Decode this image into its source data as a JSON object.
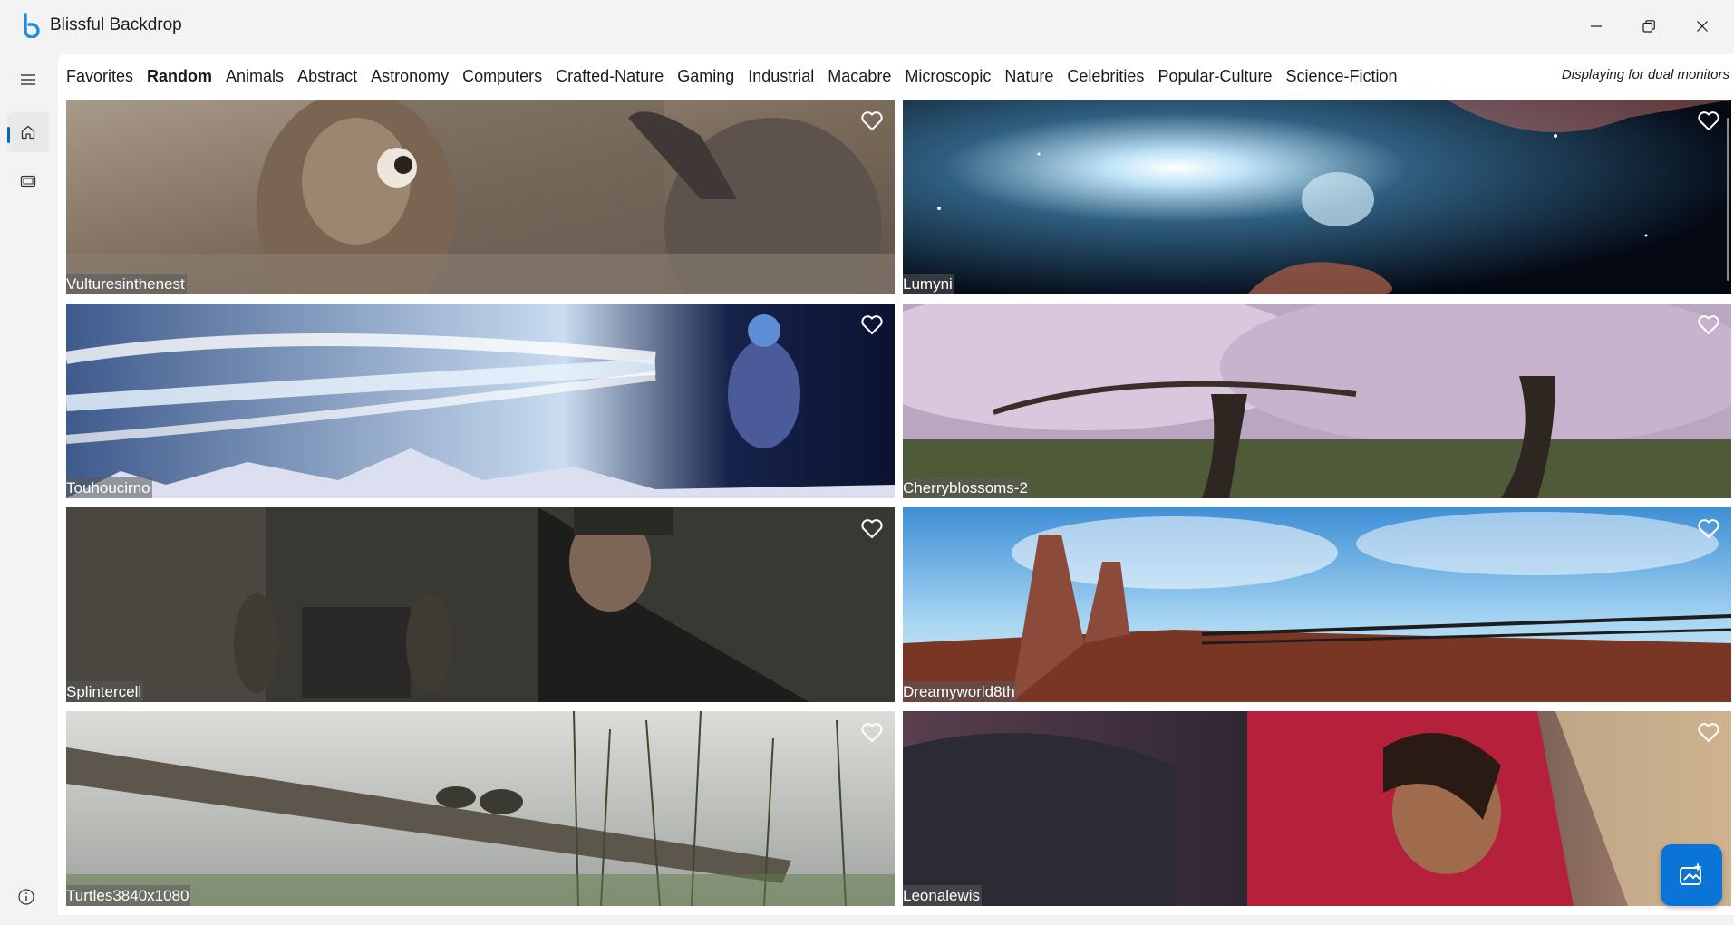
{
  "app": {
    "title": "Blissful Backdrop"
  },
  "categories": [
    {
      "label": "Favorites",
      "active": false
    },
    {
      "label": "Random",
      "active": true
    },
    {
      "label": "Animals",
      "active": false
    },
    {
      "label": "Abstract",
      "active": false
    },
    {
      "label": "Astronomy",
      "active": false
    },
    {
      "label": "Computers",
      "active": false
    },
    {
      "label": "Crafted-Nature",
      "active": false
    },
    {
      "label": "Gaming",
      "active": false
    },
    {
      "label": "Industrial",
      "active": false
    },
    {
      "label": "Macabre",
      "active": false
    },
    {
      "label": "Microscopic",
      "active": false
    },
    {
      "label": "Nature",
      "active": false
    },
    {
      "label": "Celebrities",
      "active": false
    },
    {
      "label": "Popular-Culture",
      "active": false
    },
    {
      "label": "Science-Fiction",
      "active": false
    }
  ],
  "display_note": "Displaying for dual monitors",
  "wallpapers": [
    {
      "name": "Vulturesinthenest"
    },
    {
      "name": "Lumyni"
    },
    {
      "name": "Touhoucirno"
    },
    {
      "name": "Cherryblossoms-2"
    },
    {
      "name": "Splintercell"
    },
    {
      "name": "Dreamyworld8th"
    },
    {
      "name": "Turtles3840x1080"
    },
    {
      "name": "Leonalewis"
    }
  ],
  "colors": {
    "accent": "#0067c0",
    "fab": "#0a75d6"
  },
  "icons": {
    "rail": [
      "menu-icon",
      "home-icon",
      "monitor-icon"
    ],
    "tile": "heart-icon",
    "fab": "wand-sparkle-icon",
    "footer": "info-icon"
  }
}
